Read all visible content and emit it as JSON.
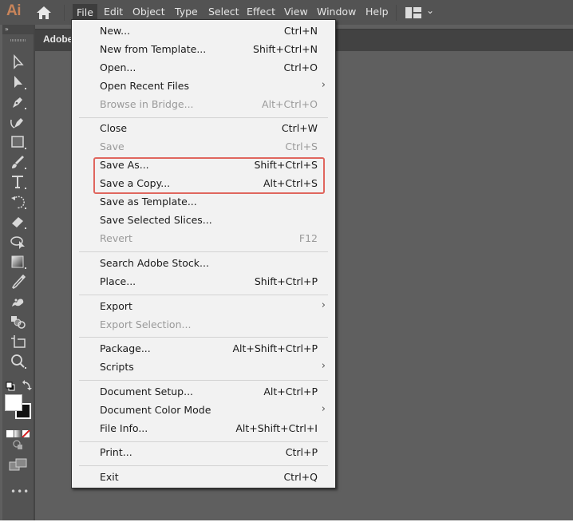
{
  "app": {
    "logo": "Ai",
    "document_tab": "Adobe",
    "brand_color": "#c8845a",
    "highlight_color": "#e0665e"
  },
  "menubar": {
    "items": [
      {
        "label": "File",
        "active": true
      },
      {
        "label": "Edit"
      },
      {
        "label": "Object"
      },
      {
        "label": "Type"
      },
      {
        "label": "Select"
      },
      {
        "label": "Effect"
      },
      {
        "label": "View"
      },
      {
        "label": "Window"
      },
      {
        "label": "Help"
      }
    ],
    "workspace_icon": "workspace-switcher-icon"
  },
  "toolbar": {
    "collapse_label": "»",
    "tools": [
      "selection-tool",
      "direct-selection-tool",
      "pen-tool",
      "curvature-tool",
      "rectangle-tool",
      "paintbrush-tool",
      "type-tool",
      "rotate-tool",
      "eraser-tool",
      "shape-builder-tool",
      "gradient-tool",
      "eyedropper-tool",
      "puppet-warp-tool",
      "blend-tool",
      "artboard-tool",
      "zoom-tool"
    ]
  },
  "file_menu": {
    "items": [
      {
        "label": "New...",
        "shortcut": "Ctrl+N"
      },
      {
        "label": "New from Template...",
        "shortcut": "Shift+Ctrl+N"
      },
      {
        "label": "Open...",
        "shortcut": "Ctrl+O"
      },
      {
        "label": "Open Recent Files",
        "submenu": true
      },
      {
        "label": "Browse in Bridge...",
        "shortcut": "Alt+Ctrl+O",
        "disabled": true
      },
      {
        "label": "Close",
        "shortcut": "Ctrl+W"
      },
      {
        "label": "Save",
        "shortcut": "Ctrl+S",
        "disabled": true
      },
      {
        "label": "Save As...",
        "shortcut": "Shift+Ctrl+S",
        "highlighted": true
      },
      {
        "label": "Save a Copy...",
        "shortcut": "Alt+Ctrl+S",
        "highlighted": true
      },
      {
        "label": "Save as Template..."
      },
      {
        "label": "Save Selected Slices..."
      },
      {
        "label": "Revert",
        "shortcut": "F12",
        "disabled": true
      },
      {
        "label": "Search Adobe Stock..."
      },
      {
        "label": "Place...",
        "shortcut": "Shift+Ctrl+P"
      },
      {
        "label": "Export",
        "submenu": true
      },
      {
        "label": "Export Selection...",
        "disabled": true
      },
      {
        "label": "Package...",
        "shortcut": "Alt+Shift+Ctrl+P"
      },
      {
        "label": "Scripts",
        "submenu": true
      },
      {
        "label": "Document Setup...",
        "shortcut": "Alt+Ctrl+P"
      },
      {
        "label": "Document Color Mode",
        "submenu": true
      },
      {
        "label": "File Info...",
        "shortcut": "Alt+Shift+Ctrl+I"
      },
      {
        "label": "Print...",
        "shortcut": "Ctrl+P"
      },
      {
        "label": "Exit",
        "shortcut": "Ctrl+Q"
      }
    ],
    "submenu_arrow": "›"
  }
}
